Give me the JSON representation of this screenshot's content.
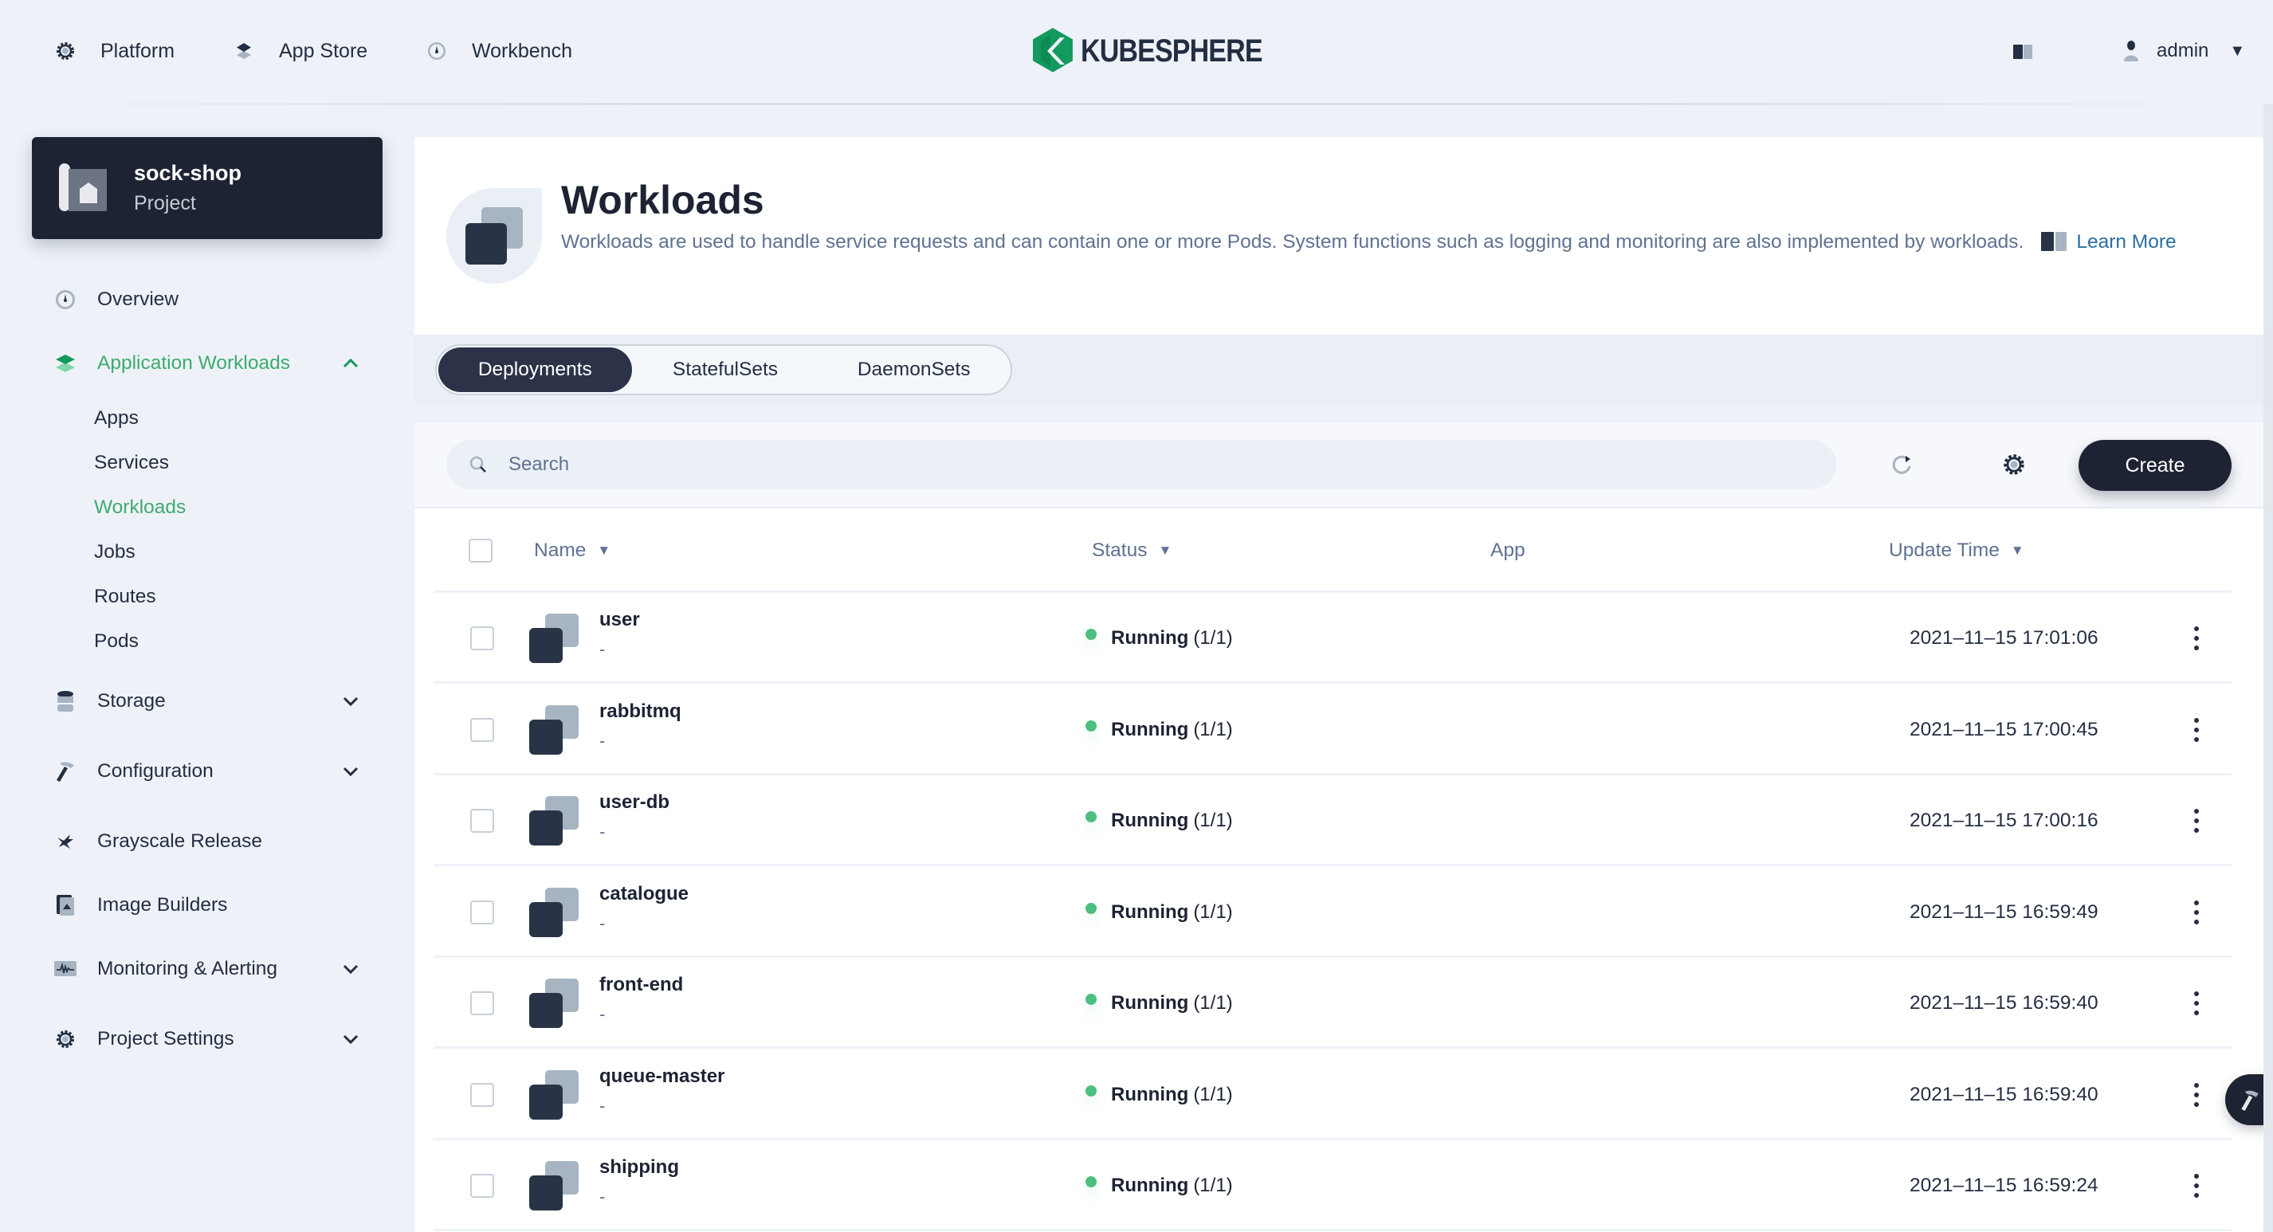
{
  "topnav": {
    "items": [
      {
        "label": "Platform",
        "icon": "gear-icon"
      },
      {
        "label": "App Store",
        "icon": "layers-icon"
      },
      {
        "label": "Workbench",
        "icon": "dashboard-icon"
      }
    ],
    "logo_text": "KUBESPHERE",
    "user": "admin"
  },
  "project": {
    "name": "sock-shop",
    "type": "Project"
  },
  "sidebar": {
    "items": [
      {
        "label": "Overview",
        "icon": "dashboard-icon"
      },
      {
        "label": "Application Workloads",
        "icon": "layers-icon",
        "expanded": true,
        "active": true
      },
      {
        "label": "Storage",
        "icon": "database-icon"
      },
      {
        "label": "Configuration",
        "icon": "hammer-icon"
      },
      {
        "label": "Grayscale Release",
        "icon": "bird-icon"
      },
      {
        "label": "Image Builders",
        "icon": "image-builder-icon"
      },
      {
        "label": "Monitoring & Alerting",
        "icon": "monitor-icon"
      },
      {
        "label": "Project Settings",
        "icon": "gear-icon"
      }
    ],
    "sub_items": [
      "Apps",
      "Services",
      "Workloads",
      "Jobs",
      "Routes",
      "Pods"
    ],
    "active_sub": "Workloads"
  },
  "header": {
    "title": "Workloads",
    "description": "Workloads are used to handle service requests and can contain one or more Pods. System functions such as logging and monitoring are also implemented by workloads.",
    "learn_more": "Learn More"
  },
  "tabs": [
    "Deployments",
    "StatefulSets",
    "DaemonSets"
  ],
  "active_tab": "Deployments",
  "toolbar": {
    "search_placeholder": "Search",
    "create_label": "Create"
  },
  "table": {
    "columns": [
      "Name",
      "Status",
      "App",
      "Update Time"
    ],
    "rows": [
      {
        "name": "user",
        "desc": "-",
        "status": "Running",
        "replicas": "(1/1)",
        "app": "",
        "time": "2021–11–15 17:01:06"
      },
      {
        "name": "rabbitmq",
        "desc": "-",
        "status": "Running",
        "replicas": "(1/1)",
        "app": "",
        "time": "2021–11–15 17:00:45"
      },
      {
        "name": "user-db",
        "desc": "-",
        "status": "Running",
        "replicas": "(1/1)",
        "app": "",
        "time": "2021–11–15 17:00:16"
      },
      {
        "name": "catalogue",
        "desc": "-",
        "status": "Running",
        "replicas": "(1/1)",
        "app": "",
        "time": "2021–11–15 16:59:49"
      },
      {
        "name": "front-end",
        "desc": "-",
        "status": "Running",
        "replicas": "(1/1)",
        "app": "",
        "time": "2021–11–15 16:59:40"
      },
      {
        "name": "queue-master",
        "desc": "-",
        "status": "Running",
        "replicas": "(1/1)",
        "app": "",
        "time": "2021–11–15 16:59:40"
      },
      {
        "name": "shipping",
        "desc": "-",
        "status": "Running",
        "replicas": "(1/1)",
        "app": "",
        "time": "2021–11–15 16:59:24"
      }
    ]
  },
  "colors": {
    "accent_green": "#3eab6e",
    "status_running": "#4dbf7e",
    "dark": "#1d2333",
    "link": "#2b6ea2"
  }
}
